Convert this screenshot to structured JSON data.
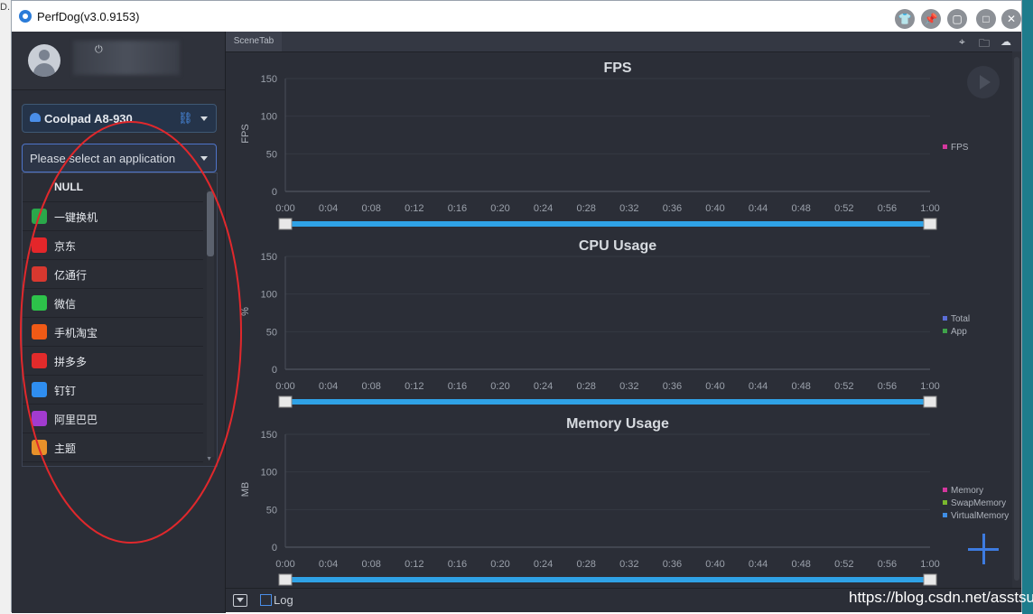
{
  "window": {
    "title": "PerfDog(v3.0.9153)"
  },
  "outer": {
    "left_fragment": "D."
  },
  "sidebar": {
    "device": "Coolpad A8-930",
    "app_placeholder": "Please select an application",
    "apps": [
      {
        "label": "NULL",
        "color": ""
      },
      {
        "label": "一键换机",
        "color": "#2aa84a"
      },
      {
        "label": "京东",
        "color": "#e4262a"
      },
      {
        "label": "亿通行",
        "color": "#d8382f"
      },
      {
        "label": "微信",
        "color": "#2dc24a"
      },
      {
        "label": "手机淘宝",
        "color": "#f05a16"
      },
      {
        "label": "拼多多",
        "color": "#e22b2b"
      },
      {
        "label": "钉钉",
        "color": "#2f8ef0"
      },
      {
        "label": "阿里巴巴",
        "color": "#a23bcf"
      },
      {
        "label": "主题",
        "color": "#e8912a"
      }
    ]
  },
  "main": {
    "scene_tab": "SceneTab"
  },
  "bottom": {
    "log_label": "Log"
  },
  "watermark": "https://blog.csdn.net/asstsui",
  "colors": {
    "accent": "#4a8ee8",
    "range_bar": "#2fa2e6",
    "annotation": "#e0282c"
  },
  "chart_data": [
    {
      "type": "line",
      "title": "FPS",
      "ylabel": "FPS",
      "yticks": [
        0,
        50,
        100,
        150
      ],
      "ylim": [
        0,
        150
      ],
      "xticks": [
        "0:00",
        "0:04",
        "0:08",
        "0:12",
        "0:16",
        "0:20",
        "0:24",
        "0:28",
        "0:32",
        "0:36",
        "0:40",
        "0:44",
        "0:48",
        "0:52",
        "0:56",
        "1:00"
      ],
      "series": [
        {
          "name": "FPS",
          "color": "#d4379e",
          "values": []
        }
      ],
      "legend": "right"
    },
    {
      "type": "line",
      "title": "CPU Usage",
      "ylabel": "%",
      "yticks": [
        0,
        50,
        100,
        150
      ],
      "ylim": [
        0,
        150
      ],
      "xticks": [
        "0:00",
        "0:04",
        "0:08",
        "0:12",
        "0:16",
        "0:20",
        "0:24",
        "0:28",
        "0:32",
        "0:36",
        "0:40",
        "0:44",
        "0:48",
        "0:52",
        "0:56",
        "1:00"
      ],
      "series": [
        {
          "name": "Total",
          "color": "#5b6dd6",
          "values": []
        },
        {
          "name": "App",
          "color": "#3fa34a",
          "values": []
        }
      ],
      "legend": "right"
    },
    {
      "type": "line",
      "title": "Memory Usage",
      "ylabel": "MB",
      "yticks": [
        0,
        50,
        100,
        150
      ],
      "ylim": [
        0,
        150
      ],
      "xticks": [
        "0:00",
        "0:04",
        "0:08",
        "0:12",
        "0:16",
        "0:20",
        "0:24",
        "0:28",
        "0:32",
        "0:36",
        "0:40",
        "0:44",
        "0:48",
        "0:52",
        "0:56",
        "1:00"
      ],
      "series": [
        {
          "name": "Memory",
          "color": "#d4379e",
          "values": []
        },
        {
          "name": "SwapMemory",
          "color": "#7ab82e",
          "values": []
        },
        {
          "name": "VirtualMemory",
          "color": "#3f8ee6",
          "values": []
        }
      ],
      "legend": "right"
    }
  ]
}
